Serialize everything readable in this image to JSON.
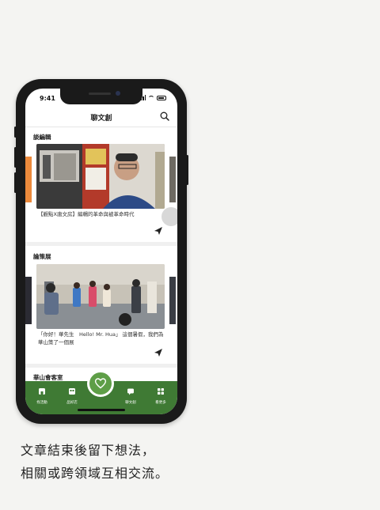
{
  "status_bar": {
    "time": "9:41"
  },
  "header": {
    "title": "聊文創"
  },
  "sections": [
    {
      "title": "談編輯",
      "caption": "【觀點X唐文房】編輯的革命與被革命時代"
    },
    {
      "title": "論策展",
      "caption": "「你好！華先生　Hello! Mr. Hua」 這個暑假，我們為華山策了一個展"
    },
    {
      "title": "華山會客室"
    }
  ],
  "tabs": [
    {
      "label": "找活動",
      "icon": "building-icon"
    },
    {
      "label": "品好店",
      "icon": "shop-icon"
    },
    {
      "label": "",
      "icon": "heart-icon"
    },
    {
      "label": "聊文創",
      "icon": "chat-icon"
    },
    {
      "label": "看更多",
      "icon": "grid-icon"
    }
  ],
  "caption_lines": [
    "文章結束後留下想法，",
    "相關或跨領域互相交流。"
  ],
  "colors": {
    "tabbar": "#3f7a34",
    "accent": "#5e9e47"
  }
}
